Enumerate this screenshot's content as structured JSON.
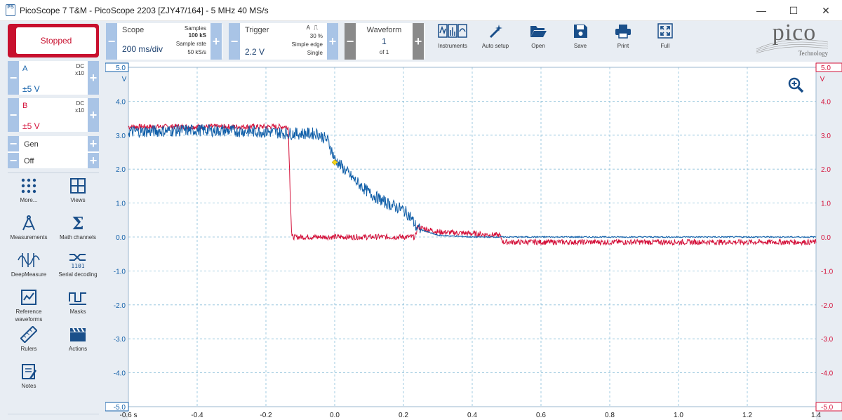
{
  "window": {
    "icon_text": "PS",
    "title": "PicoScope 7 T&M  - PicoScope 2203 [ZJY47/164] - 5 MHz 40 MS/s"
  },
  "controls": {
    "run_state": "Stopped",
    "scope": {
      "label": "Scope",
      "timebase": "200 ms/div",
      "samples_label": "Samples",
      "samples": "100 kS",
      "rate_label": "Sample rate",
      "rate": "50 kS/s"
    },
    "trigger": {
      "label": "Trigger",
      "level": "2.2 V",
      "channel": "A",
      "pre_trigger": "30 %",
      "type": "Simple edge",
      "mode": "Single"
    },
    "waveform": {
      "label": "Waveform",
      "index": "1",
      "count": "of 1"
    },
    "channel_a": {
      "name": "A",
      "range": "±5 V",
      "coupling": "DC",
      "probe": "x10"
    },
    "channel_b": {
      "name": "B",
      "range": "±5 V",
      "coupling": "DC",
      "probe": "x10"
    },
    "gen": {
      "label": "Gen",
      "state": "Off"
    }
  },
  "toolbar": {
    "instruments": "Instruments",
    "auto_setup": "Auto setup",
    "open": "Open",
    "save": "Save",
    "print": "Print",
    "full": "Full"
  },
  "logo": {
    "brand": "pico",
    "sub": "Technology"
  },
  "tools": {
    "more": "More...",
    "views": "Views",
    "measurements": "Measurements",
    "math": "Math channels",
    "deepmeasure": "DeepMeasure",
    "serial": "Serial decoding",
    "reference_1": "Reference",
    "reference_2": "waveforms",
    "masks": "Masks",
    "rulers": "Rulers",
    "actions": "Actions",
    "notes": "Notes"
  },
  "colors": {
    "channel_a": "#0f5ea8",
    "channel_b": "#d4113a",
    "grid": "#8bbfd9",
    "accent": "#c8102e"
  },
  "chart_data": {
    "type": "line",
    "x_unit": "s",
    "y_unit_left": "V",
    "y_unit_right": "V",
    "xlim": [
      -0.6,
      1.4
    ],
    "ylim": [
      -5,
      5
    ],
    "x_ticks": [
      "-0.6 s",
      "-0.4",
      "-0.2",
      "0.0",
      "0.2",
      "0.4",
      "0.6",
      "0.8",
      "1.0",
      "1.2",
      "1.4"
    ],
    "y_ticks": [
      "5.0",
      "4.0",
      "3.0",
      "2.0",
      "1.0",
      "0.0",
      "-1.0",
      "-2.0",
      "-3.0",
      "-4.0",
      "-5.0"
    ],
    "grid": true,
    "trigger_marker": {
      "x": 0.0,
      "y": 2.2
    },
    "series": [
      {
        "name": "A",
        "color": "#0f5ea8",
        "x": [
          -0.6,
          -0.4,
          -0.2,
          -0.13,
          -0.05,
          -0.02,
          0.0,
          0.05,
          0.1,
          0.15,
          0.2,
          0.22,
          0.24,
          0.3,
          0.4,
          0.5,
          1.0,
          1.4
        ],
        "y": [
          3.1,
          3.15,
          3.1,
          3.05,
          3.05,
          2.85,
          2.3,
          1.75,
          1.3,
          1.0,
          0.8,
          0.6,
          0.25,
          0.05,
          0.0,
          0.0,
          0.0,
          0.0
        ]
      },
      {
        "name": "B",
        "color": "#d4113a",
        "x": [
          -0.6,
          -0.4,
          -0.2,
          -0.135,
          -0.13,
          -0.125,
          0.0,
          0.2,
          0.235,
          0.24,
          0.3,
          0.4,
          0.48,
          0.49,
          1.0,
          1.4
        ],
        "y": [
          3.25,
          3.25,
          3.25,
          3.25,
          1.5,
          0.0,
          0.0,
          0.0,
          0.0,
          0.3,
          0.15,
          0.1,
          0.05,
          -0.15,
          -0.15,
          -0.15
        ]
      }
    ]
  }
}
